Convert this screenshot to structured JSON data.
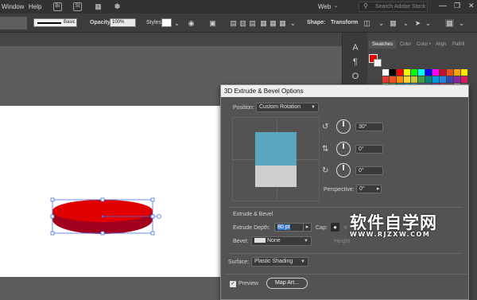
{
  "menubar": {
    "items": [
      "Window",
      "Help"
    ],
    "badges": [
      "Br",
      "St"
    ],
    "workspace": "Web",
    "search_placeholder": "Search Adobe Stock"
  },
  "controlbar": {
    "stroke_style": "Basic",
    "opacity_label": "Opacity:",
    "opacity_value": "100%",
    "styles_label": "Styles:",
    "shape_label": "Shape:",
    "transform_label": "Transform"
  },
  "panel": {
    "tabs": [
      "Swatches",
      "Color",
      "Color •",
      "Align",
      "Pathfi"
    ],
    "fill_color": "#e00000",
    "swatch_rows": [
      [
        "#ffffff",
        "#000000",
        "#ff0000",
        "#ffff00",
        "#00ff00",
        "#00ffff",
        "#0000ff",
        "#ff00ff",
        "#c8102e",
        "#e94e1b",
        "#f7a600",
        "#ffe600"
      ],
      [
        "#e53935",
        "#f4511e",
        "#fb8c00",
        "#fdd835",
        "#c0ca33",
        "#43a047",
        "#00897b",
        "#039be5",
        "#1e88e5",
        "#3949ab",
        "#8e24aa",
        "#d81b60"
      ],
      [
        "#9ccc65",
        "#66bb6a",
        "#26a69a",
        "#29b6f6",
        "#42a5f5",
        "#5c6bc0",
        "#7e57c2",
        "#ab47bc",
        "#ec407a",
        "#8d6e63",
        "#bdbdbd",
        "#757575"
      ]
    ]
  },
  "dialog": {
    "title": "3D Extrude & Bevel Options",
    "position_label": "Position:",
    "position_value": "Custom Rotation",
    "rot_x": "30°",
    "rot_y": "0°",
    "rot_z": "0°",
    "perspective_label": "Perspective:",
    "perspective_value": "0°",
    "section_extrude": "Extrude & Bevel",
    "depth_label": "Extrude Depth:",
    "depth_value": "80 pt",
    "cap_label": "Cap:",
    "bevel_label": "Bevel:",
    "bevel_value": "None",
    "height_label": "Height",
    "surface_label": "Surface:",
    "surface_value": "Plastic Shading",
    "preview_label": "Preview",
    "map_art_label": "Map Art..."
  },
  "watermark": {
    "big": "软件自学网",
    "small": "WWW.RJZXW.COM"
  },
  "colors": {
    "ellipse_top": "#e00000",
    "ellipse_side": "#a3001e",
    "cube_top": "#5aa6bf",
    "cube_bottom": "#cfcfcf",
    "selection": "#4a6fe3"
  }
}
